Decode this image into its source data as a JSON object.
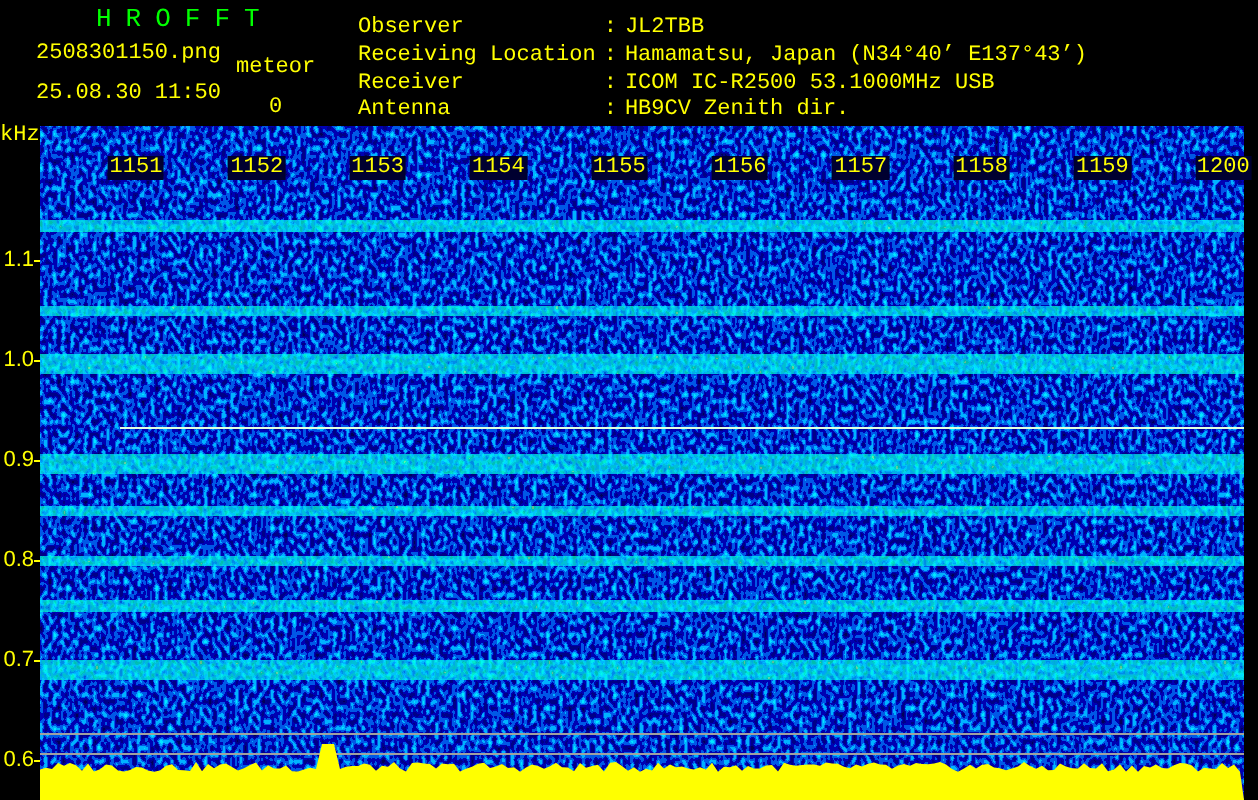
{
  "app_title": "HROFFT",
  "file_name": "2508301150.png",
  "timestamp": "25.08.30 11:50",
  "meteor": {
    "label": "meteor",
    "count": "0"
  },
  "station_info": [
    {
      "label": "Observer",
      "separator": ":",
      "value": "JL2TBB"
    },
    {
      "label": "Receiving Location",
      "separator": ":",
      "value": "Hamamatsu, Japan (N34°40’ E137°43’)"
    },
    {
      "label": "Receiver",
      "separator": ":",
      "value": "ICOM IC-R2500 53.1000MHz USB"
    },
    {
      "label": "Antenna",
      "separator": ":",
      "value": "HB9CV Zenith dir."
    }
  ],
  "spectrogram": {
    "y_unit": "kHz",
    "y_labels": [
      "1.1",
      "1.0",
      "0.9",
      "0.8",
      "0.7",
      "0.6"
    ],
    "x_labels": [
      "1151",
      "1152",
      "1153",
      "1154",
      "1155",
      "1156",
      "1157",
      "1158",
      "1159",
      "1200"
    ]
  }
}
